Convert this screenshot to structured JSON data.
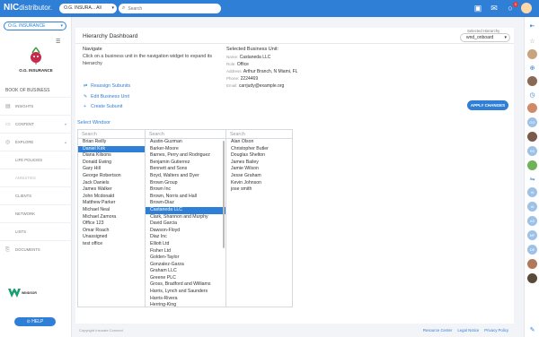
{
  "brand": {
    "logo": "NIC",
    "logo_sub": "distributor."
  },
  "topbar": {
    "org_select": "O.G. INSURA... All",
    "search_placeholder": "Search",
    "notification_count": "1"
  },
  "sidebar": {
    "org_select": "O.G. INSURANCE",
    "org_name": "O.G. INSURANCE",
    "book_of_business": "BOOK OF BUSINESS",
    "nav": [
      {
        "label": "INSIGHTS",
        "icon": "chart-icon"
      },
      {
        "label": "CONTENT",
        "icon": "content-icon"
      },
      {
        "label": "EXPLORE",
        "icon": "explore-icon"
      },
      {
        "label": "LIFE POLICIES"
      },
      {
        "label": "ANNUITIES"
      },
      {
        "label": "CLIENTS"
      },
      {
        "label": "NETWORK"
      },
      {
        "label": "LISTS"
      },
      {
        "label": "DOCUMENTS",
        "icon": "documents-icon"
      }
    ],
    "windsor_logo_text": "WINDSOR",
    "help_label": "HELP"
  },
  "main": {
    "title": "Hierarchy Dashboard",
    "selected_hierarchy_label": "Selected Hierarchy",
    "selected_hierarchy_value": "wnd_onboard",
    "navigate_title": "Navigate",
    "navigate_desc": "Click on a business unit in the navigation widget to expand its hierarchy",
    "bu_title": "Selected Business Unit:",
    "bu": {
      "name_label": "Name:",
      "name": "Castaneda LLC",
      "role_label": "Role:",
      "role": "Office",
      "address_label": "Address:",
      "address": "Arthur Branch, N Miami, FL",
      "phone_label": "Phone:",
      "phone": "2224469",
      "email_label": "Email:",
      "email": "carrjudy@example.org"
    },
    "actions": [
      "Reassign Subunits",
      "Edit Business Unit",
      "Create Subunit"
    ],
    "apply_label": "APPLY CHANGES",
    "select_label": "Select Windsor",
    "search_placeholder": "Search",
    "col1": [
      "Brian Reilly",
      "Daniel Kirk",
      "Diana Kilsons",
      "Donald Ewing",
      "Gary Hill",
      "George Robertson",
      "Jack Daniels",
      "James Walker",
      "John Mcdonald",
      "Matthew Parker",
      "Michael Neal",
      "Michael Zamora",
      "Office 123",
      "Omar Roach",
      "Unassigned",
      "test office"
    ],
    "col1_selected": 1,
    "col2": [
      "Austin-Guzman",
      "Barker-Moore",
      "Barnes, Perry and Rodriguez",
      "Benjamin Gutierrez",
      "Bennett and Sons",
      "Boyd, Walters and Dyer",
      "Brown Group",
      "Brown Inc",
      "Brown, Norris and Hall",
      "Brown-Diaz",
      "Castaneda LLC",
      "Clark, Shannon and Murphy",
      "David Garcia",
      "Dawson-Floyd",
      "Diaz Inc",
      "Elliott Ltd",
      "Fisher Ltd",
      "Golden-Taylor",
      "Gonzalez-Garza",
      "Graham LLC",
      "Greene PLC",
      "Gross, Bradford and Williams",
      "Harris, Lynch and Saunders",
      "Harris-Rivera",
      "Herring-King"
    ],
    "col2_selected": 10,
    "col3": [
      "Alan Olson",
      "Christopher Butler",
      "Douglas Shelton",
      "James Bailey",
      "Jamie Wilson",
      "Jesse Graham",
      "Kevin Johnson",
      "jose smith"
    ]
  },
  "footer": {
    "copyright": "Copyright Insurate Connect",
    "links": [
      "Resource Center",
      "Legal Notice",
      "Privacy Policy"
    ]
  },
  "rail": {
    "initials": [
      "GG",
      "SS",
      "IA",
      "IA",
      "AS",
      "MF",
      "DE"
    ]
  },
  "colors": {
    "accent": "#2f7fd6",
    "topbar": "#2f7fd6"
  }
}
